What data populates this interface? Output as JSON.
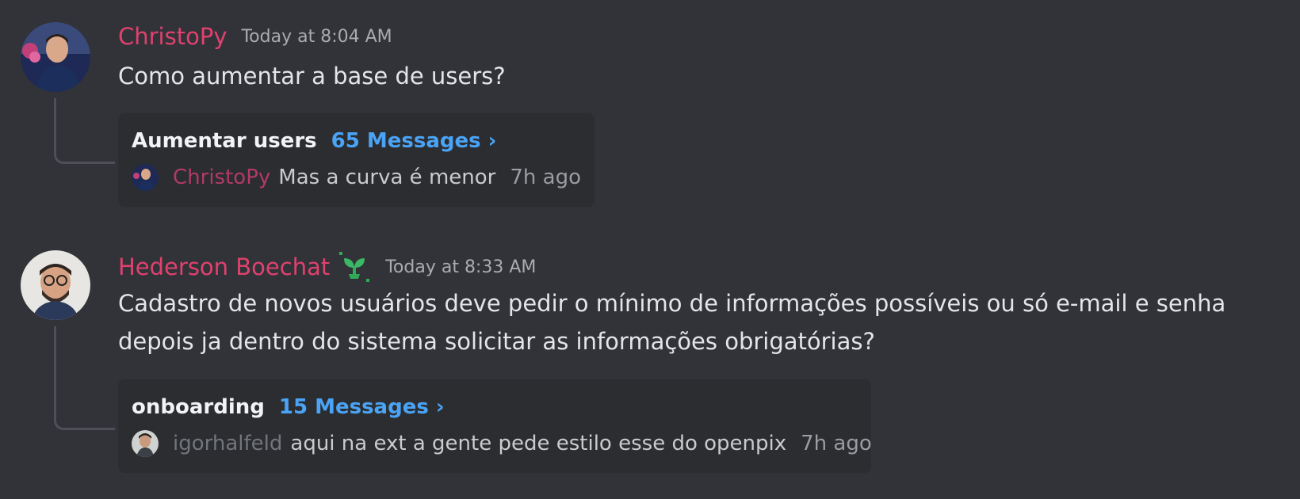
{
  "messages": [
    {
      "author": "ChristoPy",
      "timestamp": "Today at 8:04 AM",
      "content": "Como aumentar a base de users?",
      "thread": {
        "name": "Aumentar users",
        "count_label": "65 Messages ›",
        "last_author": "ChristoPy",
        "last_message": "Mas a curva é menor",
        "last_time": "7h ago"
      }
    },
    {
      "author": "Hederson Boechat",
      "badge_icon": "sprout-icon",
      "timestamp": "Today at 8:33 AM",
      "content": "Cadastro de novos usuários deve pedir o mínimo de informações possíveis ou só e-mail e senha depois ja dentro do sistema solicitar as informações obrigatórias?",
      "thread": {
        "name": "onboarding",
        "count_label": "15 Messages ›",
        "last_author": "igorhalfeld",
        "last_message": "aqui na ext a gente pede estilo esse do openpix",
        "last_time": "7h ago"
      }
    }
  ],
  "colors": {
    "background": "#313338",
    "author": "#e0416e",
    "link": "#4aa3f5",
    "card": "#2b2d31"
  }
}
